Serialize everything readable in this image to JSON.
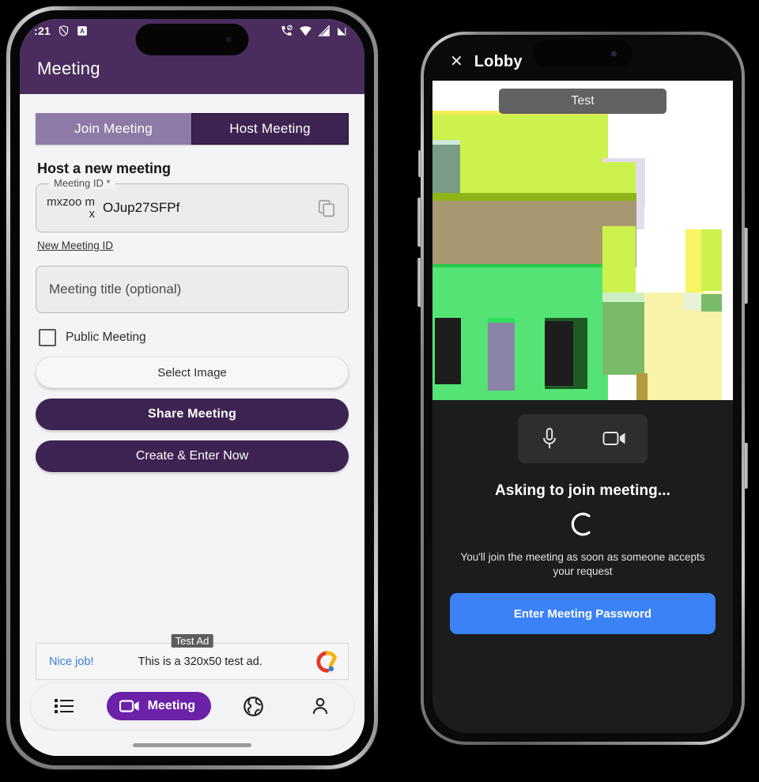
{
  "left_phone": {
    "status_bar": {
      "time": ":21",
      "icons_left": [
        "shield-icon",
        "a-badge-icon"
      ],
      "icons_right": [
        "phone-mute-icon",
        "wifi-icon",
        "signal-icon",
        "battery-icon"
      ]
    },
    "app_bar": {
      "title": "Meeting"
    },
    "tabs": [
      {
        "label": "Join Meeting",
        "active": false
      },
      {
        "label": "Host Meeting",
        "active": true
      }
    ],
    "section_title": "Host a new meeting",
    "meeting_id_field": {
      "legend": "Meeting ID *",
      "prefix": "mxzoo mx",
      "value": "OJup27SFPf",
      "copy_icon": "copy-icon"
    },
    "new_meeting_id_link": "New Meeting ID",
    "title_field": {
      "placeholder": "Meeting title (optional)"
    },
    "public_meeting": {
      "label": "Public Meeting",
      "checked": false
    },
    "buttons": {
      "select_image": "Select Image",
      "share_meeting": "Share Meeting",
      "create_enter": "Create & Enter Now"
    },
    "ad": {
      "tag": "Test Ad",
      "cta": "Nice job!",
      "text": "This is a 320x50 test ad.",
      "logo": "admob-logo-icon"
    },
    "bottom_nav": [
      {
        "name": "list",
        "icon": "list-icon",
        "label": "",
        "active": false
      },
      {
        "name": "meeting",
        "icon": "video-camera-icon",
        "label": "Meeting",
        "active": true
      },
      {
        "name": "explore",
        "icon": "globe-icon",
        "label": "",
        "active": false
      },
      {
        "name": "profile",
        "icon": "person-icon",
        "label": "",
        "active": false
      }
    ]
  },
  "right_phone": {
    "top_bar": {
      "close_icon": "close-icon",
      "title": "Lobby"
    },
    "video": {
      "name_chip": "Test"
    },
    "controls": [
      {
        "name": "microphone",
        "icon": "microphone-icon"
      },
      {
        "name": "camera",
        "icon": "video-camera-icon"
      }
    ],
    "status_title": "Asking to join meeting...",
    "spinner": "loading-spinner-icon",
    "sub_note": "You'll join the meeting as soon as someone accepts your request",
    "password_button": "Enter Meeting Password"
  },
  "colors": {
    "brand_purple": "#4a2d5e",
    "tab_active": "#3d2352",
    "tab_inactive": "#8d7aa6",
    "nav_pill": "#6b21a8",
    "accent_blue": "#3b82f6",
    "ad_link_blue": "#3d7ce0",
    "dark_bg": "#1c1c1c"
  }
}
